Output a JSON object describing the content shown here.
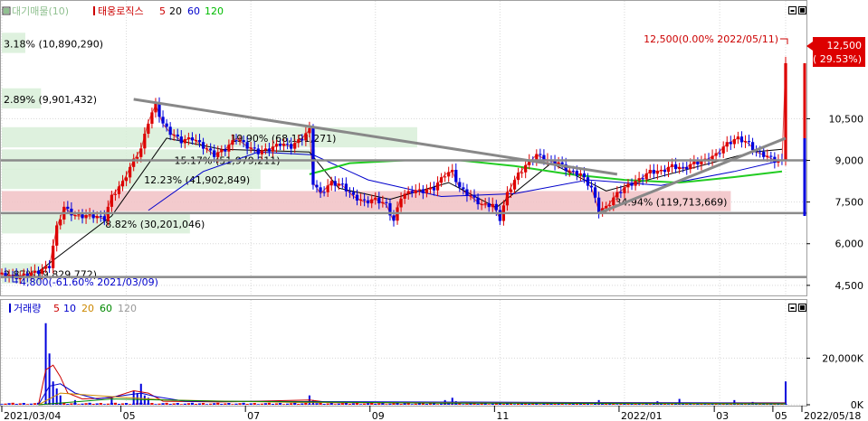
{
  "legend_top": {
    "items": [
      {
        "icon": "square-marker",
        "text": "대기매물(10)",
        "color": "#90c090"
      },
      {
        "icon": "bar-marker",
        "text": "태웅로직스",
        "color": "#cc0000"
      },
      {
        "text": "5",
        "color": "#cc0000"
      },
      {
        "text": "20",
        "color": "#000000"
      },
      {
        "text": "60",
        "color": "#0000cc"
      },
      {
        "text": "120",
        "color": "#00bb00"
      }
    ]
  },
  "legend_bottom": {
    "items": [
      {
        "icon": "bar-marker",
        "text": "거래량",
        "color": "#0000cc"
      },
      {
        "text": "5",
        "color": "#cc0000"
      },
      {
        "text": "10",
        "color": "#0000cc"
      },
      {
        "text": "20",
        "color": "#cc8800"
      },
      {
        "text": "60",
        "color": "#008800"
      },
      {
        "text": "120",
        "color": "#999999"
      }
    ]
  },
  "panel_buttons": [
    "minimize-icon",
    "restore-icon"
  ],
  "chart_data": [
    {
      "type": "candlestick",
      "title": "태웅로직스",
      "x_tick_labels": [
        "2021/03/04",
        "05",
        "07",
        "09",
        "11",
        "2022/01",
        "03",
        "05",
        "2022/05/18"
      ],
      "y_tick_labels": [
        "4,500",
        "6,000",
        "7,500",
        "9,000",
        "10,500"
      ],
      "ylim": [
        4300,
        13800
      ],
      "grid": true,
      "last_price": {
        "value": "12,500",
        "change": "( 29.53%)"
      },
      "price_annotations": {
        "high": "12,500(0.00% 2022/05/11)",
        "low": "4,800(-61.60% 2021/03/09)"
      },
      "volume_profile": [
        {
          "label": "3.18% (10,890,290)",
          "price": 13200,
          "ratio": 0.03
        },
        {
          "label": "2.89% (9,901,432)",
          "price": 11200,
          "ratio": 0.05
        },
        {
          "label": "19.90% (68,191,271)",
          "price": 9800,
          "ratio": 0.53
        },
        {
          "label": "15.17% (51,979,211)",
          "price": 9000,
          "ratio": 0.4
        },
        {
          "label": "12.23% (41,902,849)",
          "price": 8300,
          "ratio": 0.33
        },
        {
          "label": "34.94% (119,713,669)",
          "price": 7500,
          "ratio": 0.93
        },
        {
          "label": "8.82% (30,201,046)",
          "price": 6700,
          "ratio": 0.24
        },
        {
          "label": "2.87% (9,829,772)",
          "price": 4900,
          "ratio": 0.05
        }
      ],
      "series_names": [
        "5",
        "20",
        "60",
        "120"
      ],
      "close_path": [
        [
          0,
          4900
        ],
        [
          4,
          4800
        ],
        [
          10,
          5000
        ],
        [
          13,
          5200
        ],
        [
          15,
          6600
        ],
        [
          17,
          7300
        ],
        [
          20,
          7000
        ],
        [
          25,
          7000
        ],
        [
          28,
          6900
        ],
        [
          30,
          7700
        ],
        [
          33,
          8200
        ],
        [
          36,
          9000
        ],
        [
          38,
          9400
        ],
        [
          40,
          10400
        ],
        [
          42,
          11000
        ],
        [
          44,
          10300
        ],
        [
          46,
          10000
        ],
        [
          49,
          9700
        ],
        [
          52,
          9800
        ],
        [
          55,
          9500
        ],
        [
          58,
          9200
        ],
        [
          61,
          9400
        ],
        [
          64,
          9800
        ],
        [
          67,
          9500
        ],
        [
          70,
          9300
        ],
        [
          73,
          9400
        ],
        [
          76,
          9600
        ],
        [
          79,
          9500
        ],
        [
          82,
          9800
        ],
        [
          84,
          10100
        ],
        [
          85,
          8200
        ],
        [
          87,
          7800
        ],
        [
          90,
          8200
        ],
        [
          93,
          8100
        ],
        [
          96,
          7700
        ],
        [
          99,
          7500
        ],
        [
          102,
          7600
        ],
        [
          105,
          7400
        ],
        [
          107,
          6800
        ],
        [
          109,
          7700
        ],
        [
          112,
          7900
        ],
        [
          115,
          7900
        ],
        [
          118,
          8000
        ],
        [
          121,
          8500
        ],
        [
          123,
          8600
        ],
        [
          125,
          8000
        ],
        [
          128,
          7700
        ],
        [
          131,
          7400
        ],
        [
          134,
          7400
        ],
        [
          136,
          6900
        ],
        [
          138,
          7800
        ],
        [
          141,
          8500
        ],
        [
          143,
          8800
        ],
        [
          146,
          9200
        ],
        [
          149,
          9000
        ],
        [
          152,
          8900
        ],
        [
          155,
          8600
        ],
        [
          158,
          8500
        ],
        [
          161,
          8000
        ],
        [
          163,
          7200
        ],
        [
          165,
          7300
        ],
        [
          168,
          7800
        ],
        [
          171,
          8100
        ],
        [
          174,
          8300
        ],
        [
          177,
          8600
        ],
        [
          180,
          8600
        ],
        [
          183,
          8800
        ],
        [
          186,
          8700
        ],
        [
          189,
          8900
        ],
        [
          192,
          9000
        ],
        [
          195,
          9200
        ],
        [
          198,
          9600
        ],
        [
          201,
          9800
        ],
        [
          204,
          9600
        ],
        [
          206,
          9300
        ],
        [
          208,
          9200
        ],
        [
          211,
          9000
        ],
        [
          213,
          9000
        ],
        [
          214,
          12500
        ]
      ],
      "ma_values": {
        "20": [
          [
            10,
            5000
          ],
          [
            30,
            7000
          ],
          [
            45,
            9800
          ],
          [
            60,
            9400
          ],
          [
            84,
            9300
          ],
          [
            92,
            8000
          ],
          [
            106,
            7600
          ],
          [
            122,
            8200
          ],
          [
            135,
            7300
          ],
          [
            150,
            8900
          ],
          [
            165,
            7900
          ],
          [
            185,
            8600
          ],
          [
            205,
            9300
          ],
          [
            213,
            9400
          ]
        ],
        "60": [
          [
            40,
            7200
          ],
          [
            55,
            8600
          ],
          [
            70,
            9300
          ],
          [
            85,
            9200
          ],
          [
            100,
            8300
          ],
          [
            120,
            7700
          ],
          [
            140,
            7800
          ],
          [
            160,
            8300
          ],
          [
            180,
            8100
          ],
          [
            200,
            8600
          ],
          [
            213,
            9000
          ]
        ],
        "120": [
          [
            84,
            8500
          ],
          [
            95,
            8900
          ],
          [
            110,
            9000
          ],
          [
            125,
            9000
          ],
          [
            140,
            8800
          ],
          [
            155,
            8500
          ],
          [
            170,
            8300
          ],
          [
            185,
            8200
          ],
          [
            200,
            8400
          ],
          [
            213,
            8600
          ]
        ]
      },
      "trendlines": [
        {
          "from": [
            36,
            11200
          ],
          "to": [
            168,
            8500
          ]
        },
        {
          "from": [
            163,
            7100
          ],
          "to": [
            214,
            9800
          ]
        }
      ],
      "horizontal_lines": [
        9000,
        7100,
        4800
      ]
    },
    {
      "type": "bar",
      "title": "거래량",
      "y_tick_labels": [
        "0K",
        "20,000K"
      ],
      "ylim": [
        0,
        38000
      ],
      "spikes": [
        [
          12,
          35000
        ],
        [
          13,
          22000
        ],
        [
          14,
          10000
        ],
        [
          15,
          7000
        ],
        [
          16,
          4000
        ],
        [
          20,
          2000
        ],
        [
          30,
          3000
        ],
        [
          36,
          6000
        ],
        [
          37,
          5000
        ],
        [
          38,
          9000
        ],
        [
          39,
          4000
        ],
        [
          40,
          3000
        ],
        [
          84,
          4000
        ],
        [
          85,
          2000
        ],
        [
          121,
          2000
        ],
        [
          123,
          3000
        ],
        [
          124,
          1500
        ],
        [
          163,
          2000
        ],
        [
          179,
          1500
        ],
        [
          185,
          2500
        ],
        [
          200,
          2000
        ],
        [
          205,
          1200
        ],
        [
          214,
          10000
        ]
      ],
      "ma5_path": [
        [
          10,
          0
        ],
        [
          12,
          15000
        ],
        [
          14,
          17000
        ],
        [
          16,
          12000
        ],
        [
          18,
          5000
        ],
        [
          22,
          2500
        ],
        [
          30,
          3000
        ],
        [
          36,
          6000
        ],
        [
          40,
          5000
        ],
        [
          44,
          1500
        ],
        [
          60,
          1200
        ],
        [
          84,
          2000
        ],
        [
          90,
          900
        ],
        [
          214,
          800
        ]
      ],
      "ma10_path": [
        [
          10,
          0
        ],
        [
          13,
          8000
        ],
        [
          16,
          9000
        ],
        [
          20,
          5000
        ],
        [
          26,
          2500
        ],
        [
          38,
          5000
        ],
        [
          42,
          3500
        ],
        [
          50,
          1500
        ],
        [
          214,
          700
        ]
      ]
    }
  ]
}
